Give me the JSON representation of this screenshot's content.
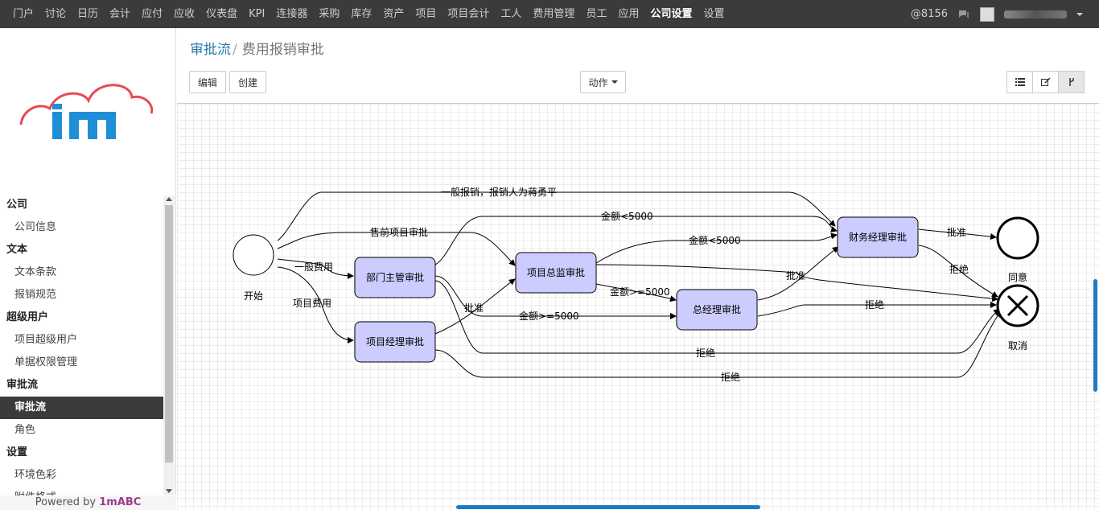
{
  "topnav": {
    "menu": [
      "门户",
      "讨论",
      "日历",
      "会计",
      "应付",
      "应收",
      "仪表盘",
      "KPI",
      "连接器",
      "采购",
      "库存",
      "资产",
      "项目",
      "项目会计",
      "工人",
      "费用管理",
      "员工",
      "应用",
      "公司设置",
      "设置"
    ],
    "active_index": 18,
    "mention_count": "@8156",
    "icons": [
      "at-icon",
      "chat-icon",
      "avatar-icon"
    ]
  },
  "sidebar": {
    "groups": [
      {
        "label": "公司",
        "items": [
          {
            "label": "公司信息"
          }
        ]
      },
      {
        "label": "文本",
        "items": [
          {
            "label": "文本条款"
          },
          {
            "label": "报销规范"
          }
        ]
      },
      {
        "label": "超级用户",
        "items": [
          {
            "label": "项目超级用户"
          },
          {
            "label": "单据权限管理"
          }
        ]
      },
      {
        "label": "审批流",
        "items": [
          {
            "label": "审批流",
            "active": true
          },
          {
            "label": "角色"
          }
        ]
      },
      {
        "label": "设置",
        "items": [
          {
            "label": "环境色彩"
          },
          {
            "label": "附件格式"
          }
        ]
      }
    ],
    "powered_prefix": "Powered by ",
    "powered_brand": "1mABC"
  },
  "main": {
    "breadcrumb": {
      "parent": "审批流",
      "sep": "/",
      "current": "费用报销审批"
    },
    "buttons": {
      "edit": "编辑",
      "create": "创建",
      "action": "动作"
    },
    "view_icons": [
      "list-view-icon",
      "form-view-icon",
      "diagram-view-icon"
    ],
    "colors": {
      "node_fill": "#ccccff",
      "accent": "#2a7ab0",
      "scroll": "#1e7bc0"
    }
  },
  "workflow": {
    "nodes": {
      "start": "开始",
      "dept": "部门主管审批",
      "pm": "项目经理审批",
      "pd": "项目总监审批",
      "gm": "总经理审批",
      "fm": "财务经理审批",
      "agree": "同意",
      "cancel": "取消"
    },
    "edges": {
      "e1": "一般报销，报销人为蒋勇平",
      "e2": "售前项目审批",
      "e3": "一般费用",
      "e4": "项目费用",
      "e5": "金额<5000",
      "e6": "金额<5000",
      "e7": "金额>=5000",
      "e8": "金额>=5000",
      "e9": "批准",
      "e10": "批准",
      "e11": "批准",
      "e12": "拒绝",
      "e13": "拒绝",
      "e14": "拒绝",
      "e15": "拒绝"
    }
  }
}
